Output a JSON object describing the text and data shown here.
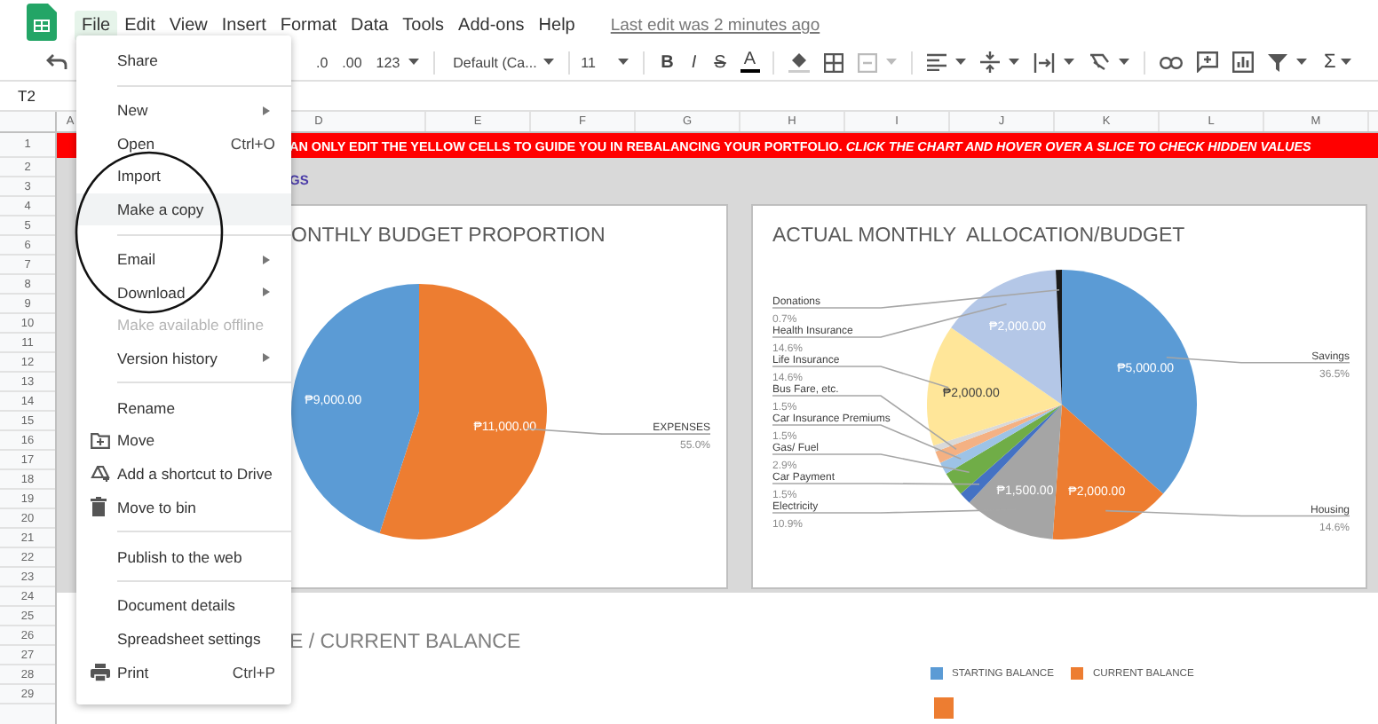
{
  "menubar": {
    "items": [
      {
        "label": "File",
        "selected": true
      },
      {
        "label": "Edit",
        "selected": false
      },
      {
        "label": "View",
        "selected": false
      },
      {
        "label": "Insert",
        "selected": false
      },
      {
        "label": "Format",
        "selected": false
      },
      {
        "label": "Data",
        "selected": false
      },
      {
        "label": "Tools",
        "selected": false
      },
      {
        "label": "Add-ons",
        "selected": false
      },
      {
        "label": "Help",
        "selected": false
      }
    ],
    "last_edit": "Last edit was 2 minutes ago"
  },
  "toolbar": {
    "decimal_decrease": ".0",
    "decimal_increase": ".00",
    "number_format": "123",
    "font": "Default (Ca...",
    "font_size": "11",
    "bold": "B",
    "italic": "I",
    "strikethrough": "S",
    "text_color": "A",
    "functions": "Σ"
  },
  "cell_reference": "T2",
  "columns": [
    {
      "label": "A"
    },
    {
      "label": "D"
    },
    {
      "label": "E"
    },
    {
      "label": "F"
    },
    {
      "label": "G"
    },
    {
      "label": "H"
    },
    {
      "label": "I"
    },
    {
      "label": "J"
    },
    {
      "label": "K"
    },
    {
      "label": "L"
    },
    {
      "label": "M"
    }
  ],
  "rows": [
    "1",
    "2",
    "3",
    "4",
    "5",
    "6",
    "7",
    "8",
    "9",
    "10",
    "11",
    "12",
    "13",
    "14",
    "15",
    "16",
    "17",
    "18",
    "19",
    "20",
    "21",
    "22",
    "23",
    "24",
    "25",
    "26",
    "27",
    "28",
    "29"
  ],
  "banner": "AN ONLY EDIT THE YELLOW CELLS TO GUIDE YOU IN REBALANCING YOUR PORTFOLIO. *CLICK THE CHART AND HOVER OVER A SLICE TO CHECK HIDDEN VALUES*",
  "row3_text": "GS",
  "charts": [
    {
      "chart_data": {
        "type": "pie",
        "title": "ONTHLY BUDGET PROPORTION",
        "values": [
          11000,
          9000
        ],
        "colors": [
          "#ed7d31",
          "#5b9bd5"
        ],
        "categories": [
          "EXPENSES",
          null
        ],
        "annotations": [
          "55.0%",
          null
        ],
        "value_labels": [
          "₱11,000.00",
          "₱9,000.00"
        ]
      }
    },
    {
      "chart_data": {
        "type": "pie",
        "title": "ACTUAL MONTHLY  ALLOCATION/BUDGET",
        "values": [
          5000,
          2000,
          1500,
          200,
          400,
          200,
          200,
          100,
          2000,
          2000,
          100
        ],
        "colors": [
          "#5b9bd5",
          "#ed7d31",
          "#a5a5a5",
          "#4472c4",
          "#70ad47",
          "#9dc3e6",
          "#f4b183",
          "#d9d9d9",
          "#ffe699",
          "#b4c7e7",
          "#1a1a1a"
        ],
        "categories": [
          "Savings",
          "Housing",
          "Electricity",
          "Car Payment",
          "Gas/ Fuel",
          "Car Insurance Premiums",
          "Bus Fare, etc.",
          null,
          "Life Insurance",
          "Health Insurance",
          "Donations"
        ],
        "annotations": [
          "36.5%",
          "14.6%",
          "10.9%",
          "1.5%",
          "2.9%",
          "1.5%",
          "1.5%",
          null,
          "14.6%",
          "14.6%",
          "0.7%"
        ],
        "value_labels": [
          "₱5,000.00",
          "₱2,000.00",
          "₱1,500.00",
          null,
          null,
          null,
          null,
          null,
          "₱2,000.00",
          "₱2,000.00",
          null
        ]
      }
    }
  ],
  "balance_chart": {
    "title": "E / CURRENT BALANCE",
    "legend": [
      {
        "label": "STARTING BALANCE",
        "color": "#5b9bd5"
      },
      {
        "label": "CURRENT BALANCE",
        "color": "#ed7d31"
      }
    ]
  },
  "file_menu": [
    {
      "kind": "item",
      "label": "Share",
      "submenu": false,
      "disabled": false,
      "selected": false
    },
    {
      "kind": "separator"
    },
    {
      "kind": "item",
      "label": "New",
      "submenu": true,
      "disabled": false,
      "selected": false
    },
    {
      "kind": "item",
      "label": "Open",
      "shortcut": "Ctrl+O",
      "submenu": false,
      "disabled": false,
      "selected": false
    },
    {
      "kind": "item",
      "label": "Import",
      "submenu": false,
      "disabled": false,
      "selected": false
    },
    {
      "kind": "item",
      "label": "Make a copy",
      "submenu": false,
      "disabled": false,
      "selected": true
    },
    {
      "kind": "separator"
    },
    {
      "kind": "item",
      "label": "Email",
      "submenu": true,
      "disabled": false,
      "selected": false
    },
    {
      "kind": "item",
      "label": "Download",
      "submenu": true,
      "disabled": false,
      "selected": false
    },
    {
      "kind": "item",
      "label": "Make available offline",
      "submenu": false,
      "disabled": true,
      "selected": false
    },
    {
      "kind": "item",
      "label": "Version history",
      "submenu": true,
      "disabled": false,
      "selected": false
    },
    {
      "kind": "separator"
    },
    {
      "kind": "item",
      "label": "Rename",
      "submenu": false,
      "disabled": false,
      "selected": false
    },
    {
      "kind": "item",
      "label": "Move",
      "submenu": false,
      "disabled": false,
      "selected": false
    },
    {
      "kind": "item",
      "label": "Add a shortcut to Drive",
      "submenu": false,
      "disabled": false,
      "selected": false
    },
    {
      "kind": "item",
      "label": "Move to bin",
      "submenu": false,
      "disabled": false,
      "selected": false
    },
    {
      "kind": "separator"
    },
    {
      "kind": "item",
      "label": "Publish to the web",
      "submenu": false,
      "disabled": false,
      "selected": false
    },
    {
      "kind": "separator"
    },
    {
      "kind": "item",
      "label": "Document details",
      "submenu": false,
      "disabled": false,
      "selected": false
    },
    {
      "kind": "item",
      "label": "Spreadsheet settings",
      "submenu": false,
      "disabled": false,
      "selected": false
    },
    {
      "kind": "item",
      "label": "Print",
      "shortcut": "Ctrl+P",
      "submenu": false,
      "disabled": false,
      "selected": false
    }
  ]
}
